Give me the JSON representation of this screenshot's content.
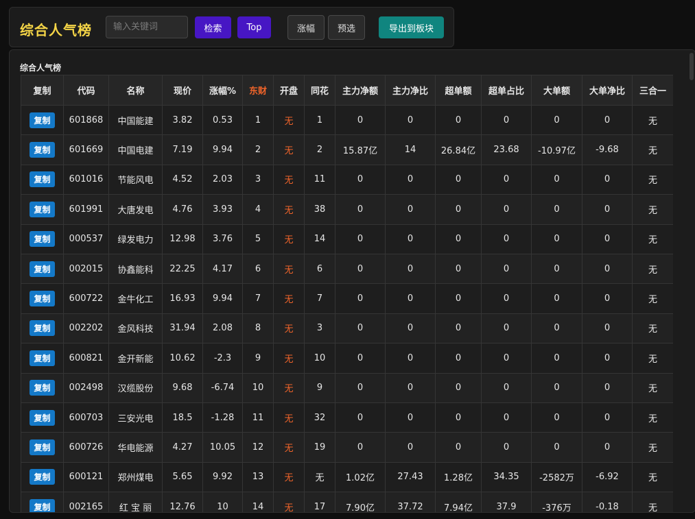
{
  "toolbar": {
    "title": "综合人气榜",
    "search_placeholder": "输入关键词",
    "search_button": "检索",
    "top_button": "Top",
    "change_button": "涨幅",
    "preselect_button": "预选",
    "export_button": "导出到板块"
  },
  "panel": {
    "title": "综合人气榜"
  },
  "table": {
    "columns": [
      "复制",
      "代码",
      "名称",
      "现价",
      "涨幅%",
      "东财",
      "开盘",
      "同花",
      "主力净额",
      "主力净比",
      "超单额",
      "超单占比",
      "大单额",
      "大单净比",
      "三合一"
    ],
    "copy_label": "复制",
    "rows": [
      [
        "601868",
        "中国能建",
        "3.82",
        "0.53",
        "1",
        "无",
        "1",
        "0",
        "0",
        "0",
        "0",
        "0",
        "0",
        "无"
      ],
      [
        "601669",
        "中国电建",
        "7.19",
        "9.94",
        "2",
        "无",
        "2",
        "15.87亿",
        "14",
        "26.84亿",
        "23.68",
        "-10.97亿",
        "-9.68",
        "无"
      ],
      [
        "601016",
        "节能风电",
        "4.52",
        "2.03",
        "3",
        "无",
        "11",
        "0",
        "0",
        "0",
        "0",
        "0",
        "0",
        "无"
      ],
      [
        "601991",
        "大唐发电",
        "4.76",
        "3.93",
        "4",
        "无",
        "38",
        "0",
        "0",
        "0",
        "0",
        "0",
        "0",
        "无"
      ],
      [
        "000537",
        "绿发电力",
        "12.98",
        "3.76",
        "5",
        "无",
        "14",
        "0",
        "0",
        "0",
        "0",
        "0",
        "0",
        "无"
      ],
      [
        "002015",
        "协鑫能科",
        "22.25",
        "4.17",
        "6",
        "无",
        "6",
        "0",
        "0",
        "0",
        "0",
        "0",
        "0",
        "无"
      ],
      [
        "600722",
        "金牛化工",
        "16.93",
        "9.94",
        "7",
        "无",
        "7",
        "0",
        "0",
        "0",
        "0",
        "0",
        "0",
        "无"
      ],
      [
        "002202",
        "金风科技",
        "31.94",
        "2.08",
        "8",
        "无",
        "3",
        "0",
        "0",
        "0",
        "0",
        "0",
        "0",
        "无"
      ],
      [
        "600821",
        "金开新能",
        "10.62",
        "-2.3",
        "9",
        "无",
        "10",
        "0",
        "0",
        "0",
        "0",
        "0",
        "0",
        "无"
      ],
      [
        "002498",
        "汉缆股份",
        "9.68",
        "-6.74",
        "10",
        "无",
        "9",
        "0",
        "0",
        "0",
        "0",
        "0",
        "0",
        "无"
      ],
      [
        "600703",
        "三安光电",
        "18.5",
        "-1.28",
        "11",
        "无",
        "32",
        "0",
        "0",
        "0",
        "0",
        "0",
        "0",
        "无"
      ],
      [
        "600726",
        "华电能源",
        "4.27",
        "10.05",
        "12",
        "无",
        "19",
        "0",
        "0",
        "0",
        "0",
        "0",
        "0",
        "无"
      ],
      [
        "600121",
        "郑州煤电",
        "5.65",
        "9.92",
        "13",
        "无",
        "无",
        "1.02亿",
        "27.43",
        "1.28亿",
        "34.35",
        "-2582万",
        "-6.92",
        "无"
      ],
      [
        "002165",
        "红 宝 丽",
        "12.76",
        "10",
        "14",
        "无",
        "17",
        "7.90亿",
        "37.72",
        "7.94亿",
        "37.9",
        "-376万",
        "-0.18",
        "无"
      ]
    ]
  },
  "colors": {
    "title": "#f5d547",
    "accent": "#f0642a",
    "primary_button": "#4716c4",
    "export_button": "#10857f",
    "copy_button": "#1479c8"
  }
}
